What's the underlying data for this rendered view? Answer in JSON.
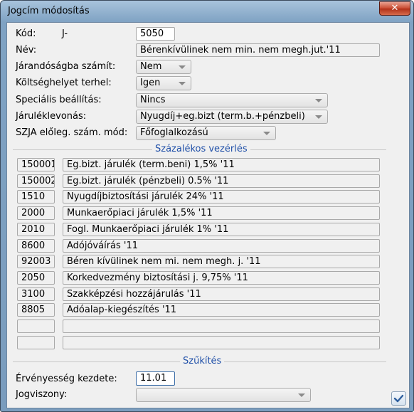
{
  "window": {
    "title": "Jogcím módosítás",
    "close_glyph": "✕"
  },
  "form": {
    "kod": {
      "label": "Kód:",
      "prefix": "J-",
      "value": "5050"
    },
    "nev": {
      "label": "Név:",
      "value": "Bérenkívülinek nem min. nem megh.jut.'11"
    },
    "jarandosag": {
      "label": "Járandóságba számít:",
      "value": "Nem"
    },
    "koltseghely": {
      "label": "Költséghelyet terhel:",
      "value": "Igen"
    },
    "specialis": {
      "label": "Speciális beállítás:",
      "value": "Nincs"
    },
    "jarulek": {
      "label": "Járuléklevonás:",
      "value": "Nyugdíj+eg.bizt (term.b.+pénzbeli)"
    },
    "szja": {
      "label": "SZJA előleg. szám. mód:",
      "value": "Főfoglalkozású"
    }
  },
  "szazalekos": {
    "title": "Százalékos vezérlés",
    "rows": [
      {
        "code": "150001",
        "name": "Eg.bizt. járulék (term.beni) 1,5%      '11"
      },
      {
        "code": "150002",
        "name": "Eg.bizt. járulék (pénzbeli) 0.5%      '11"
      },
      {
        "code": "1510",
        "name": "Nyugdíjbiztosítási járulék 24%          '11"
      },
      {
        "code": "2000",
        "name": "Munkaerőpiaci járulék 1,5%          '11"
      },
      {
        "code": "2010",
        "name": "Fogl. Munkaerőpiaci járulék 1%        '11"
      },
      {
        "code": "8600",
        "name": "Adójóváírás                                 '11"
      },
      {
        "code": "92003",
        "name": "Béren kívülinek nem mi. nem megh. j. '11"
      },
      {
        "code": "2050",
        "name": "Korkedvezmény biztosítási j. 9,75%  '11"
      },
      {
        "code": "3100",
        "name": "Szakképzési hozzájárulás                '11"
      },
      {
        "code": "8805",
        "name": "Adóalap-kiegészítés                     '11"
      },
      {
        "code": "",
        "name": ""
      },
      {
        "code": "",
        "name": ""
      }
    ]
  },
  "szukites": {
    "title": "Szűkítés",
    "ervenyesseg": {
      "label": "Érvényesség kezdete:",
      "value": "11.01"
    },
    "jogviszony": {
      "label": "Jogviszony:",
      "value": ""
    }
  },
  "icons": {
    "ok": "checkmark-icon"
  }
}
